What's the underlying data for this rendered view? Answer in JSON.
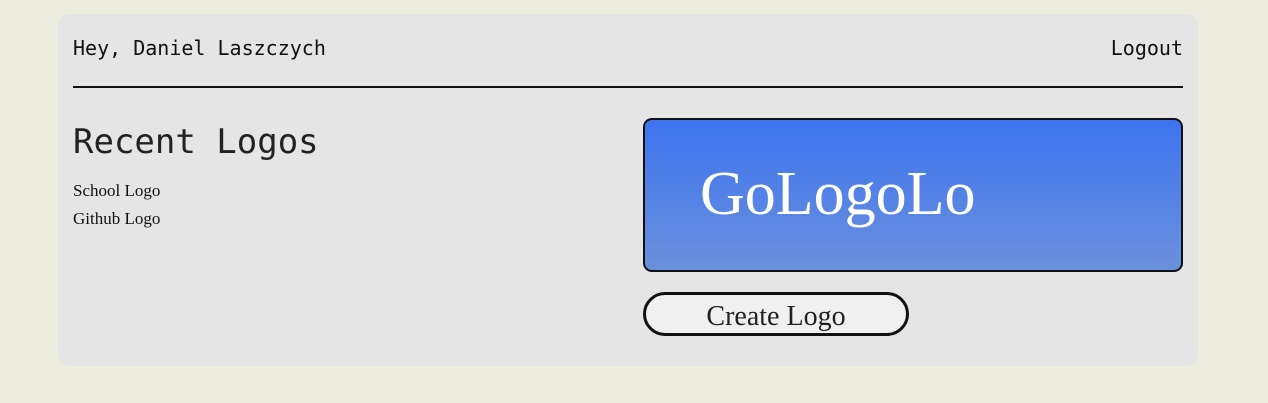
{
  "header": {
    "greeting": "Hey, Daniel Laszczych",
    "logout_label": "Logout"
  },
  "recent": {
    "title": "Recent Logos",
    "items": [
      {
        "label": "School Logo"
      },
      {
        "label": "Github Logo"
      }
    ]
  },
  "banner": {
    "text": "GoLogoLo",
    "colors": {
      "top": "#3d74ef",
      "bottom": "#6b90dc"
    }
  },
  "actions": {
    "create_label": "Create Logo"
  },
  "colors": {
    "page_background": "#ecedde",
    "card_background": "#e5e5e5"
  }
}
